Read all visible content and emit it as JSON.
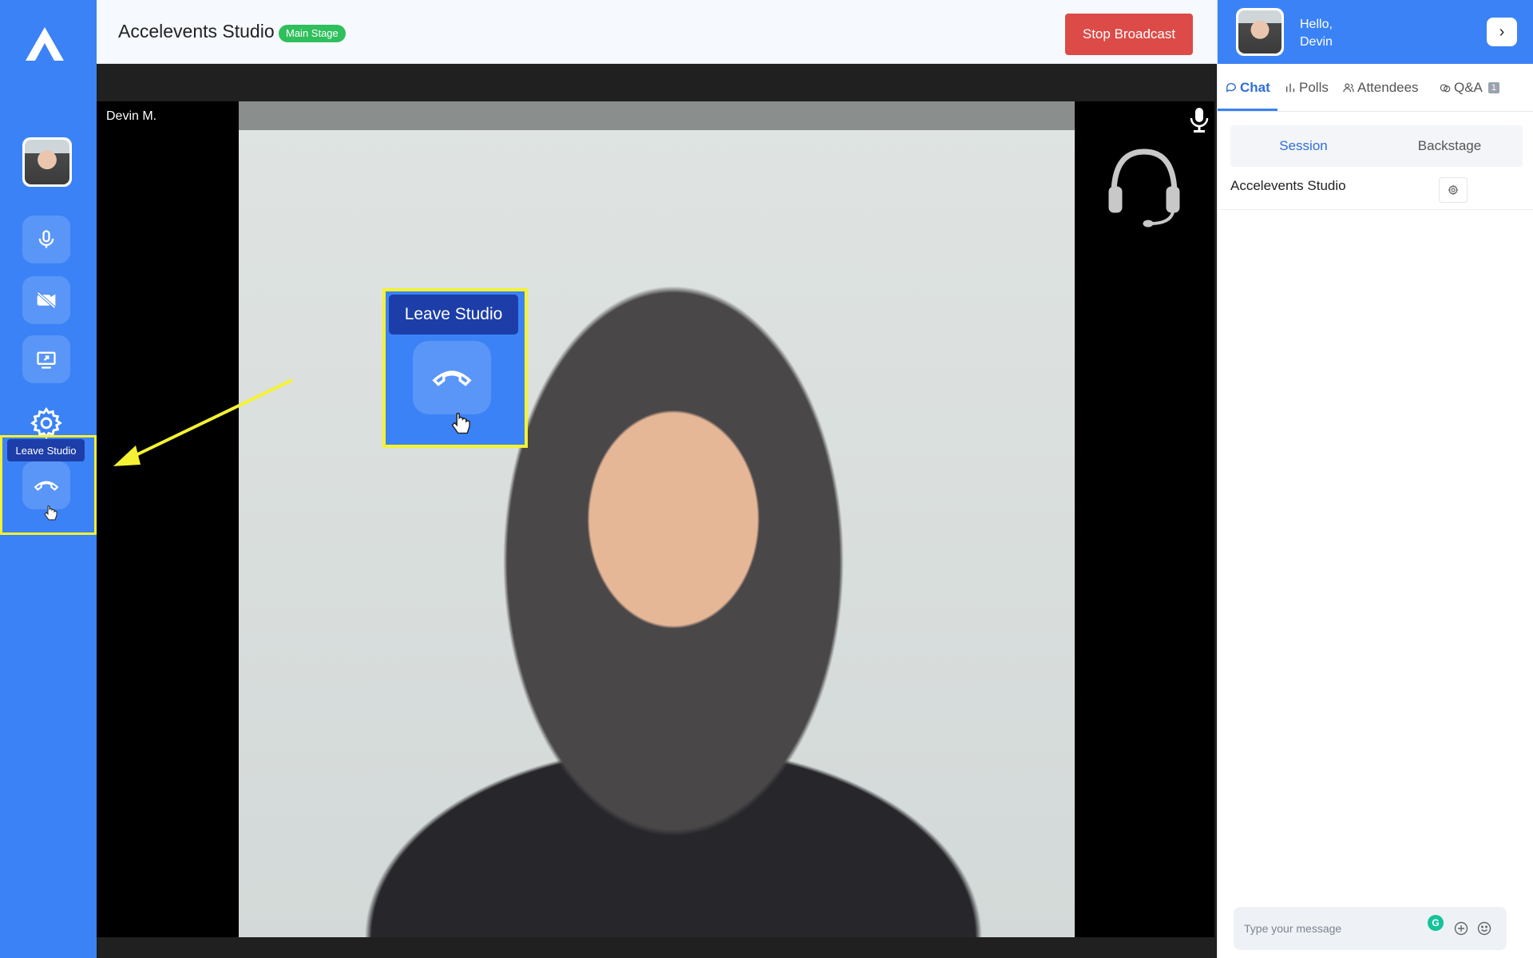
{
  "header": {
    "title": "Accelevents Studio",
    "stage_badge": "Main Stage",
    "stop_broadcast": "Stop Broadcast"
  },
  "stage": {
    "speaker_name": "Devin M.",
    "callout_tooltip": "Leave Studio"
  },
  "sidebar": {
    "leave_tooltip": "Leave Studio",
    "icons": [
      "microphone-icon",
      "camera-off-icon",
      "share-screen-icon",
      "gear-icon",
      "hangup-icon"
    ]
  },
  "right_panel": {
    "greeting_line1": "Hello,",
    "greeting_line2": "Devin",
    "tabs": [
      {
        "label": "Chat",
        "active": true
      },
      {
        "label": "Polls"
      },
      {
        "label": "Attendees"
      },
      {
        "label": "Q&A",
        "badge": "1"
      }
    ],
    "segments": [
      {
        "label": "Session",
        "active": true
      },
      {
        "label": "Backstage"
      }
    ],
    "room_title": "Accelevents Studio",
    "message_placeholder": "Type your message"
  },
  "colors": {
    "sidebar": "#3b82f6",
    "stop_button": "#dc4b47",
    "badge": "#2fbf5c",
    "highlight": "#f4f232",
    "tooltip": "#1d3ea8"
  }
}
